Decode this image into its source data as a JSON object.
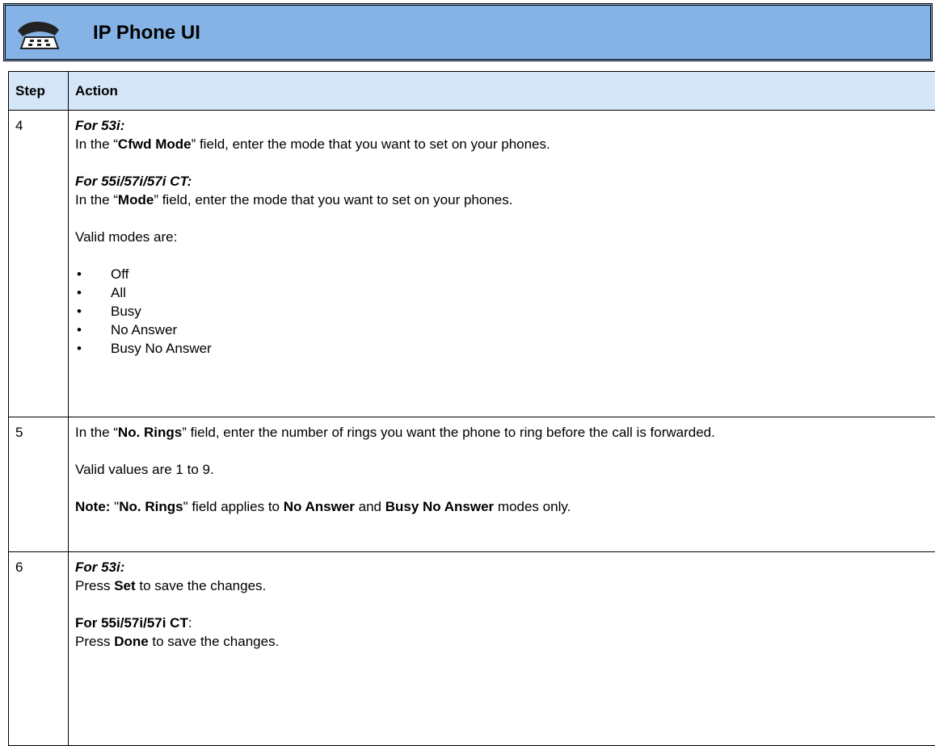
{
  "header": {
    "title": "IP Phone UI",
    "icon": "phone-handset-icon",
    "background_color": "#86b3e6"
  },
  "table": {
    "columns": [
      "Step",
      "Action"
    ],
    "header_color": "#d4e6f7",
    "steps": [
      {
        "number": "4",
        "model_53": "For 53i:",
        "cfwd_pre": "In the “",
        "cfwd_field": "Cfwd Mode",
        "cfwd_post": "” field, enter the mode that you want to set on your phones.",
        "model_55": "For 55i/57i/57i CT:",
        "mode_pre": "In the “",
        "mode_field": "Mode",
        "mode_post": "” field, enter the mode that you want to set on your phones.",
        "valid_intro": "Valid modes are:",
        "modes": [
          "Off",
          "All",
          "Busy",
          "No Answer",
          "Busy No Answer"
        ]
      },
      {
        "number": "5",
        "rings_pre": "In the “",
        "rings_field": "No. Rings",
        "rings_post": "” field, enter the number of rings you want the phone to ring before the call is forwarded.",
        "valid_values": "Valid values are 1 to 9.",
        "note_label": "Note:",
        "note_q1": " \"",
        "note_field": "No. Rings",
        "note_q2": "\" field applies to ",
        "note_mode_1": "No Answer",
        "note_and": " and ",
        "note_mode_2": "Busy No Answer",
        "note_end": " modes only."
      },
      {
        "number": "6",
        "model_53": "For 53i:",
        "set_pre": "Press ",
        "set_key": "Set",
        "set_post": " to save the changes.",
        "model_55": "For 55i/57i/57i CT",
        "model_55_colon": ":",
        "done_pre": "Press ",
        "done_key": "Done",
        "done_post": " to save the changes."
      }
    ]
  }
}
